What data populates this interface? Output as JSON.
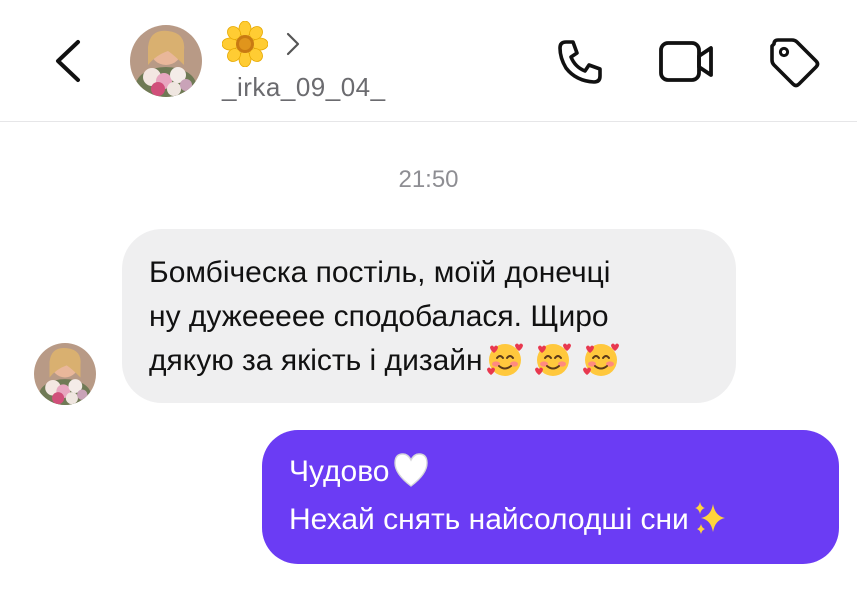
{
  "header": {
    "contact_emoji": "flower-emoji",
    "username": "_irka_09_04_",
    "icons": {
      "back": "chevron-left-icon",
      "phone": "phone-icon",
      "video": "video-camera-icon",
      "tag": "tag-icon"
    }
  },
  "thread": {
    "timestamp": "21:50",
    "incoming": {
      "lines": [
        "Бомбіческа постіль, моїй донечці",
        "ну дужеееее сподобалася. Щиро",
        "дякую за якість і дизайн"
      ],
      "trailing_emojis": [
        "smiling-face-with-hearts",
        "smiling-face-with-hearts",
        "smiling-face-with-hearts"
      ]
    },
    "outgoing": {
      "lines": [
        "Чудово",
        "Нехай снять найсолодші сни"
      ],
      "emojis": [
        "white-heart",
        "sparkles"
      ]
    }
  },
  "colors": {
    "incoming_bubble": "#efeff0",
    "outgoing_bubble": "#6b3cf4",
    "timestamp_text": "#8e8e93",
    "username_text": "#6b6b6f"
  }
}
